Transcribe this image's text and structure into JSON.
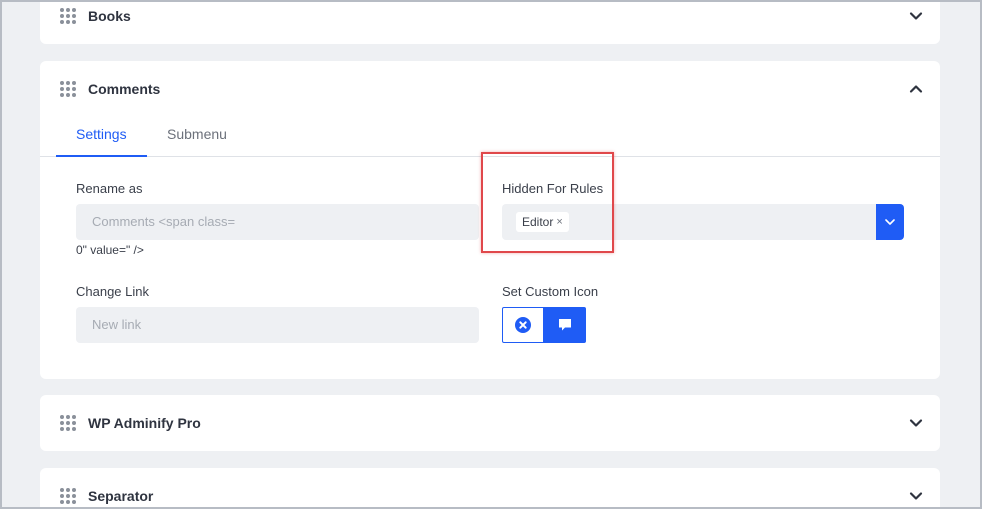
{
  "colors": {
    "accent": "#1f5cf5",
    "highlight": "#e0484b",
    "page_bg": "#eef0f3"
  },
  "panels": [
    {
      "title": "Books",
      "expanded": false
    },
    {
      "title": "Comments",
      "expanded": true
    },
    {
      "title": "WP Adminify Pro",
      "expanded": false
    },
    {
      "title": "Separator",
      "expanded": false
    }
  ],
  "comments": {
    "tabs": [
      {
        "label": "Settings",
        "active": true
      },
      {
        "label": "Submenu",
        "active": false
      }
    ],
    "rename": {
      "label": "Rename as",
      "value": "Comments <span class=",
      "overflow_text": "0\" value=\" />"
    },
    "hidden_for_rules": {
      "label": "Hidden For Rules",
      "chips": [
        {
          "label": "Editor",
          "remove": "×"
        }
      ]
    },
    "change_link": {
      "label": "Change Link",
      "placeholder": "New link"
    },
    "custom_icon": {
      "label": "Set Custom Icon",
      "icons": [
        "remove-icon",
        "comment-icon"
      ]
    }
  }
}
